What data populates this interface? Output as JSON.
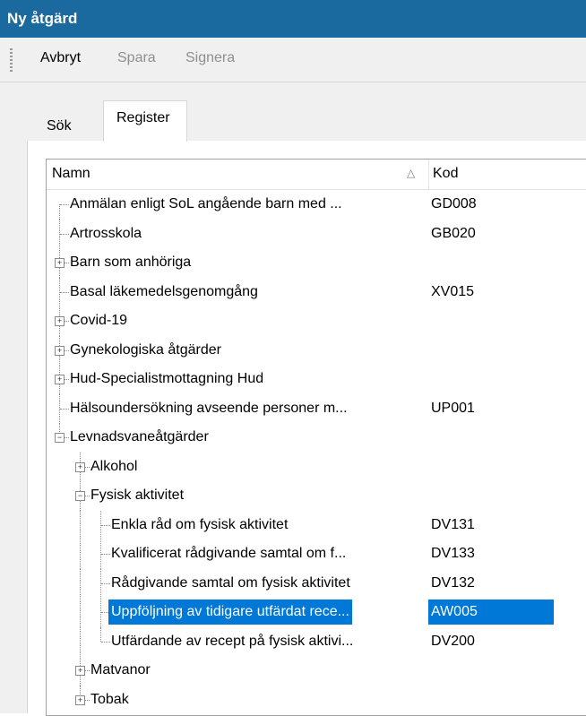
{
  "window": {
    "title": "Ny åtgärd"
  },
  "toolbar": {
    "cancel": "Avbryt",
    "save": "Spara",
    "sign": "Signera"
  },
  "tabs": [
    {
      "label": "Sök"
    },
    {
      "label": "Register"
    }
  ],
  "tree": {
    "header": {
      "name": "Namn",
      "sort_indicator": "△",
      "code": "Kod"
    },
    "rows": [
      {
        "label": "Anmälan enligt SoL angående barn med ...",
        "code": "GD008",
        "level": 0,
        "expander": "none"
      },
      {
        "label": "Artrosskola",
        "code": "GB020",
        "level": 0,
        "expander": "none"
      },
      {
        "label": "Barn som anhöriga",
        "code": "",
        "level": 0,
        "expander": "plus"
      },
      {
        "label": "Basal läkemedelsgenomgång",
        "code": "XV015",
        "level": 0,
        "expander": "none"
      },
      {
        "label": "Covid-19",
        "code": "",
        "level": 0,
        "expander": "plus"
      },
      {
        "label": "Gynekologiska åtgärder",
        "code": "",
        "level": 0,
        "expander": "plus"
      },
      {
        "label": "Hud-Specialistmottagning Hud",
        "code": "",
        "level": 0,
        "expander": "plus"
      },
      {
        "label": "Hälsoundersökning avseende personer m...",
        "code": "UP001",
        "level": 0,
        "expander": "none"
      },
      {
        "label": "Levnadsvaneåtgärder",
        "code": "",
        "level": 0,
        "expander": "minus"
      },
      {
        "label": "Alkohol",
        "code": "",
        "level": 1,
        "expander": "plus"
      },
      {
        "label": "Fysisk aktivitet",
        "code": "",
        "level": 1,
        "expander": "minus"
      },
      {
        "label": "Enkla råd om fysisk aktivitet",
        "code": "DV131",
        "level": 2,
        "expander": "none"
      },
      {
        "label": "Kvalificerat rådgivande samtal om f...",
        "code": "DV133",
        "level": 2,
        "expander": "none"
      },
      {
        "label": "Rådgivande samtal om fysisk aktivitet",
        "code": "DV132",
        "level": 2,
        "expander": "none"
      },
      {
        "label": "Uppföljning av tidigare utfärdat rece...",
        "code": "AW005",
        "level": 2,
        "expander": "none",
        "selected": true
      },
      {
        "label": "Utfärdande av recept på fysisk aktivi...",
        "code": "DV200",
        "level": 2,
        "expander": "none"
      },
      {
        "label": "Matvanor",
        "code": "",
        "level": 1,
        "expander": "plus"
      },
      {
        "label": "Tobak",
        "code": "",
        "level": 1,
        "expander": "plus"
      }
    ]
  },
  "colors": {
    "titlebar": "#1a6aa0",
    "selection": "#0078d7"
  }
}
